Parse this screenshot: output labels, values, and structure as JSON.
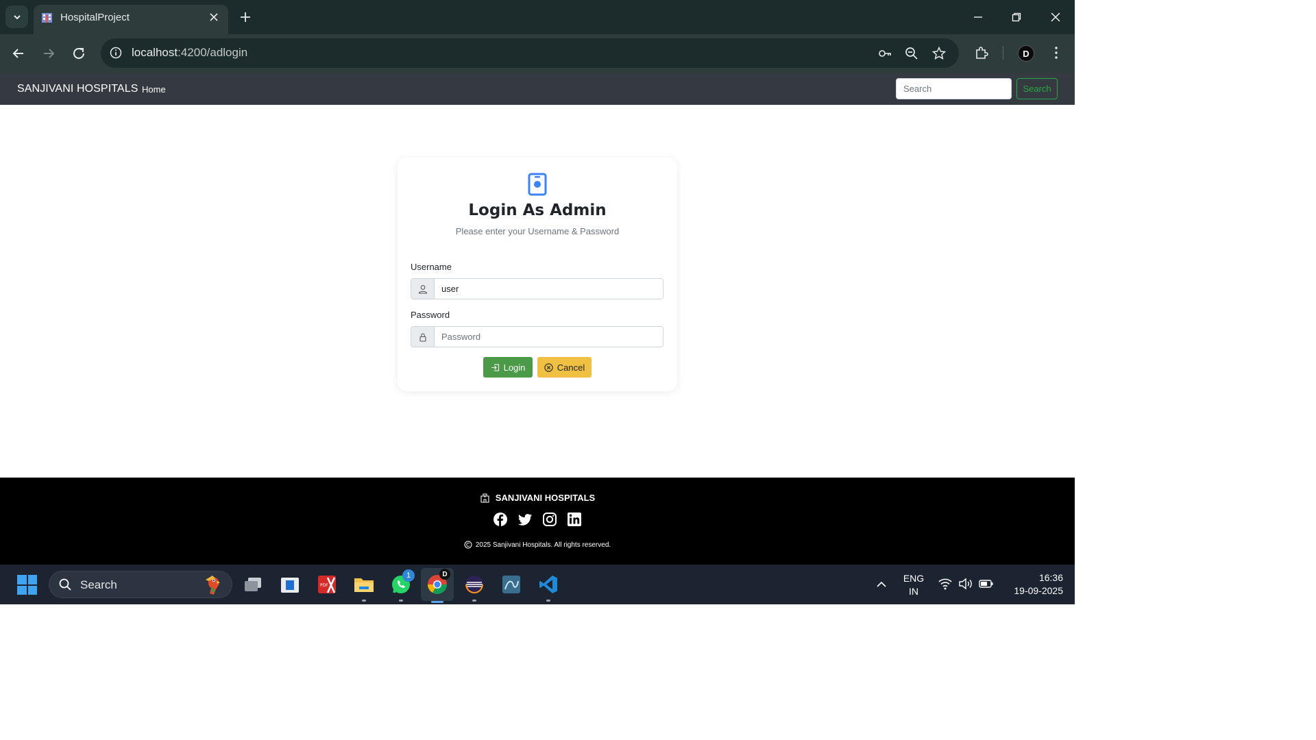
{
  "browser": {
    "tab_title": "HospitalProject",
    "url_host": "localhost",
    "url_path": ":4200/adlogin"
  },
  "navbar": {
    "brand": "SANJIVANI HOSPITALS",
    "home": "Home",
    "search_placeholder": "Search",
    "search_button": "Search"
  },
  "login": {
    "title": "Login As Admin",
    "subtitle": "Please enter your Username & Password",
    "username_label": "Username",
    "username_value": "user",
    "password_label": "Password",
    "password_placeholder": "Password",
    "login_button": "Login",
    "cancel_button": "Cancel",
    "accent_color": "#4b9a48",
    "cancel_color": "#f0c042"
  },
  "footer": {
    "brand": "SANJIVANI HOSPITALS",
    "social_icons": [
      "facebook-icon",
      "twitter-icon",
      "instagram-icon",
      "linkedin-icon"
    ],
    "copyright": "2025 Sanjivani Hospitals. All rights reserved."
  },
  "taskbar": {
    "search_label": "Search",
    "whatsapp_badge": "1",
    "lang_line1": "ENG",
    "lang_line2": "IN",
    "time": "16:36",
    "date": "19-09-2025"
  }
}
